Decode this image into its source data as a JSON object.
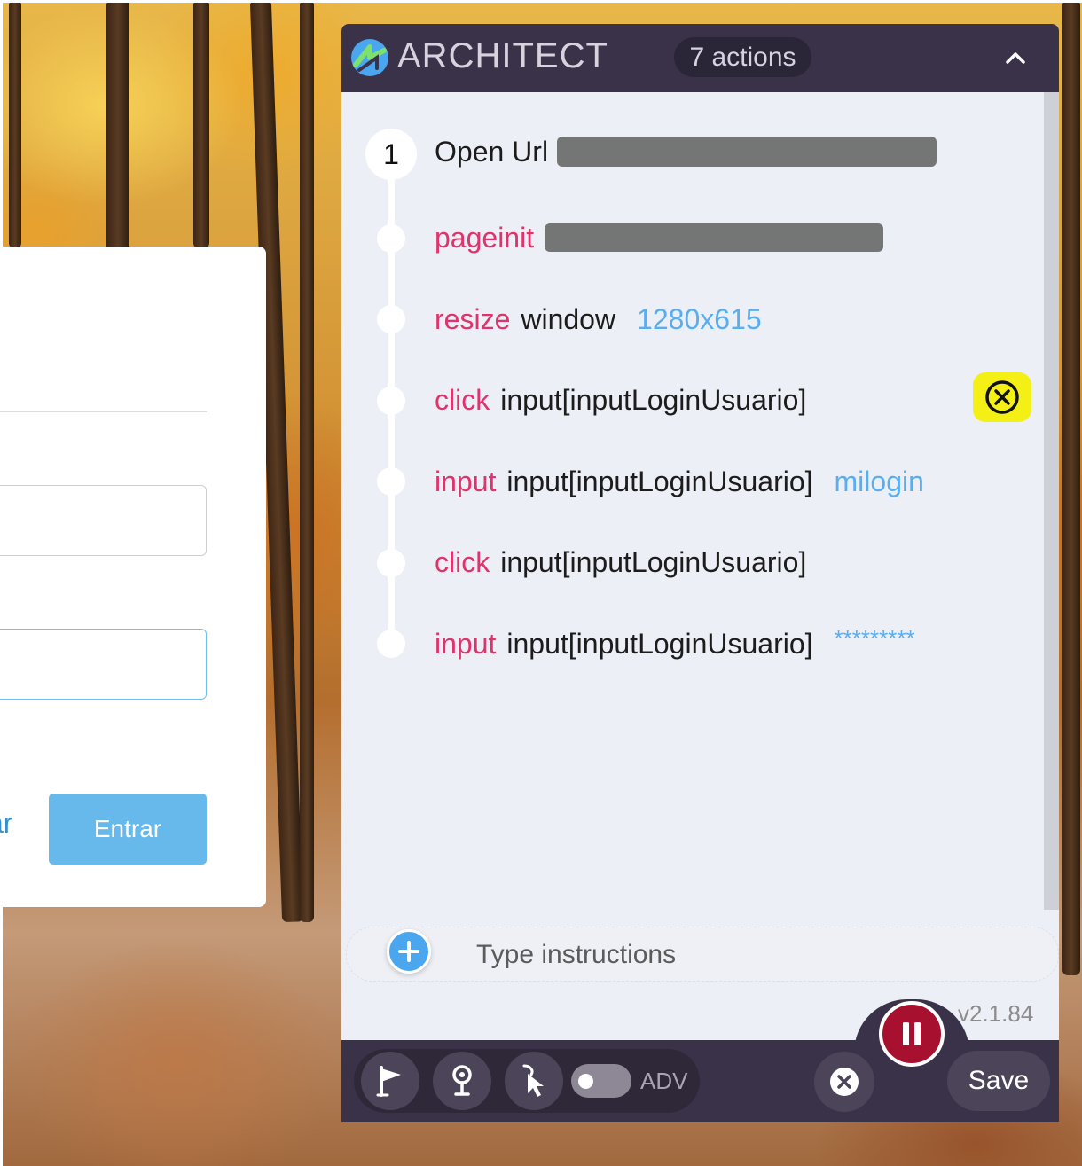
{
  "login": {
    "link_text_fragment": "ar",
    "submit_label": "Entrar"
  },
  "architect": {
    "title": "ARCHITECT",
    "actions_count_label": "7 actions",
    "steps": [
      {
        "number": "1",
        "command": "Open Url",
        "target": "",
        "value": ""
      },
      {
        "command": "pageinit",
        "target": "",
        "value": ""
      },
      {
        "command": "resize",
        "target": "window",
        "value": "1280x615"
      },
      {
        "command": "click",
        "target": "input[inputLoginUsuario]",
        "value": ""
      },
      {
        "command": "input",
        "target": "input[inputLoginUsuario]",
        "value": "milogin"
      },
      {
        "command": "click",
        "target": "input[inputLoginUsuario]",
        "value": ""
      },
      {
        "command": "input",
        "target": "input[inputLoginUsuario]",
        "value": "*********"
      }
    ],
    "instructions_placeholder": "Type instructions",
    "version": "v2.1.84",
    "adv_label": "ADV",
    "save_label": "Save"
  },
  "colors": {
    "header_bg": "#3a3249",
    "command": "#e0336b",
    "value": "#5aaef0",
    "pause": "#a81030",
    "error_highlight": "#f4f016",
    "login_button": "#66b9ea"
  }
}
